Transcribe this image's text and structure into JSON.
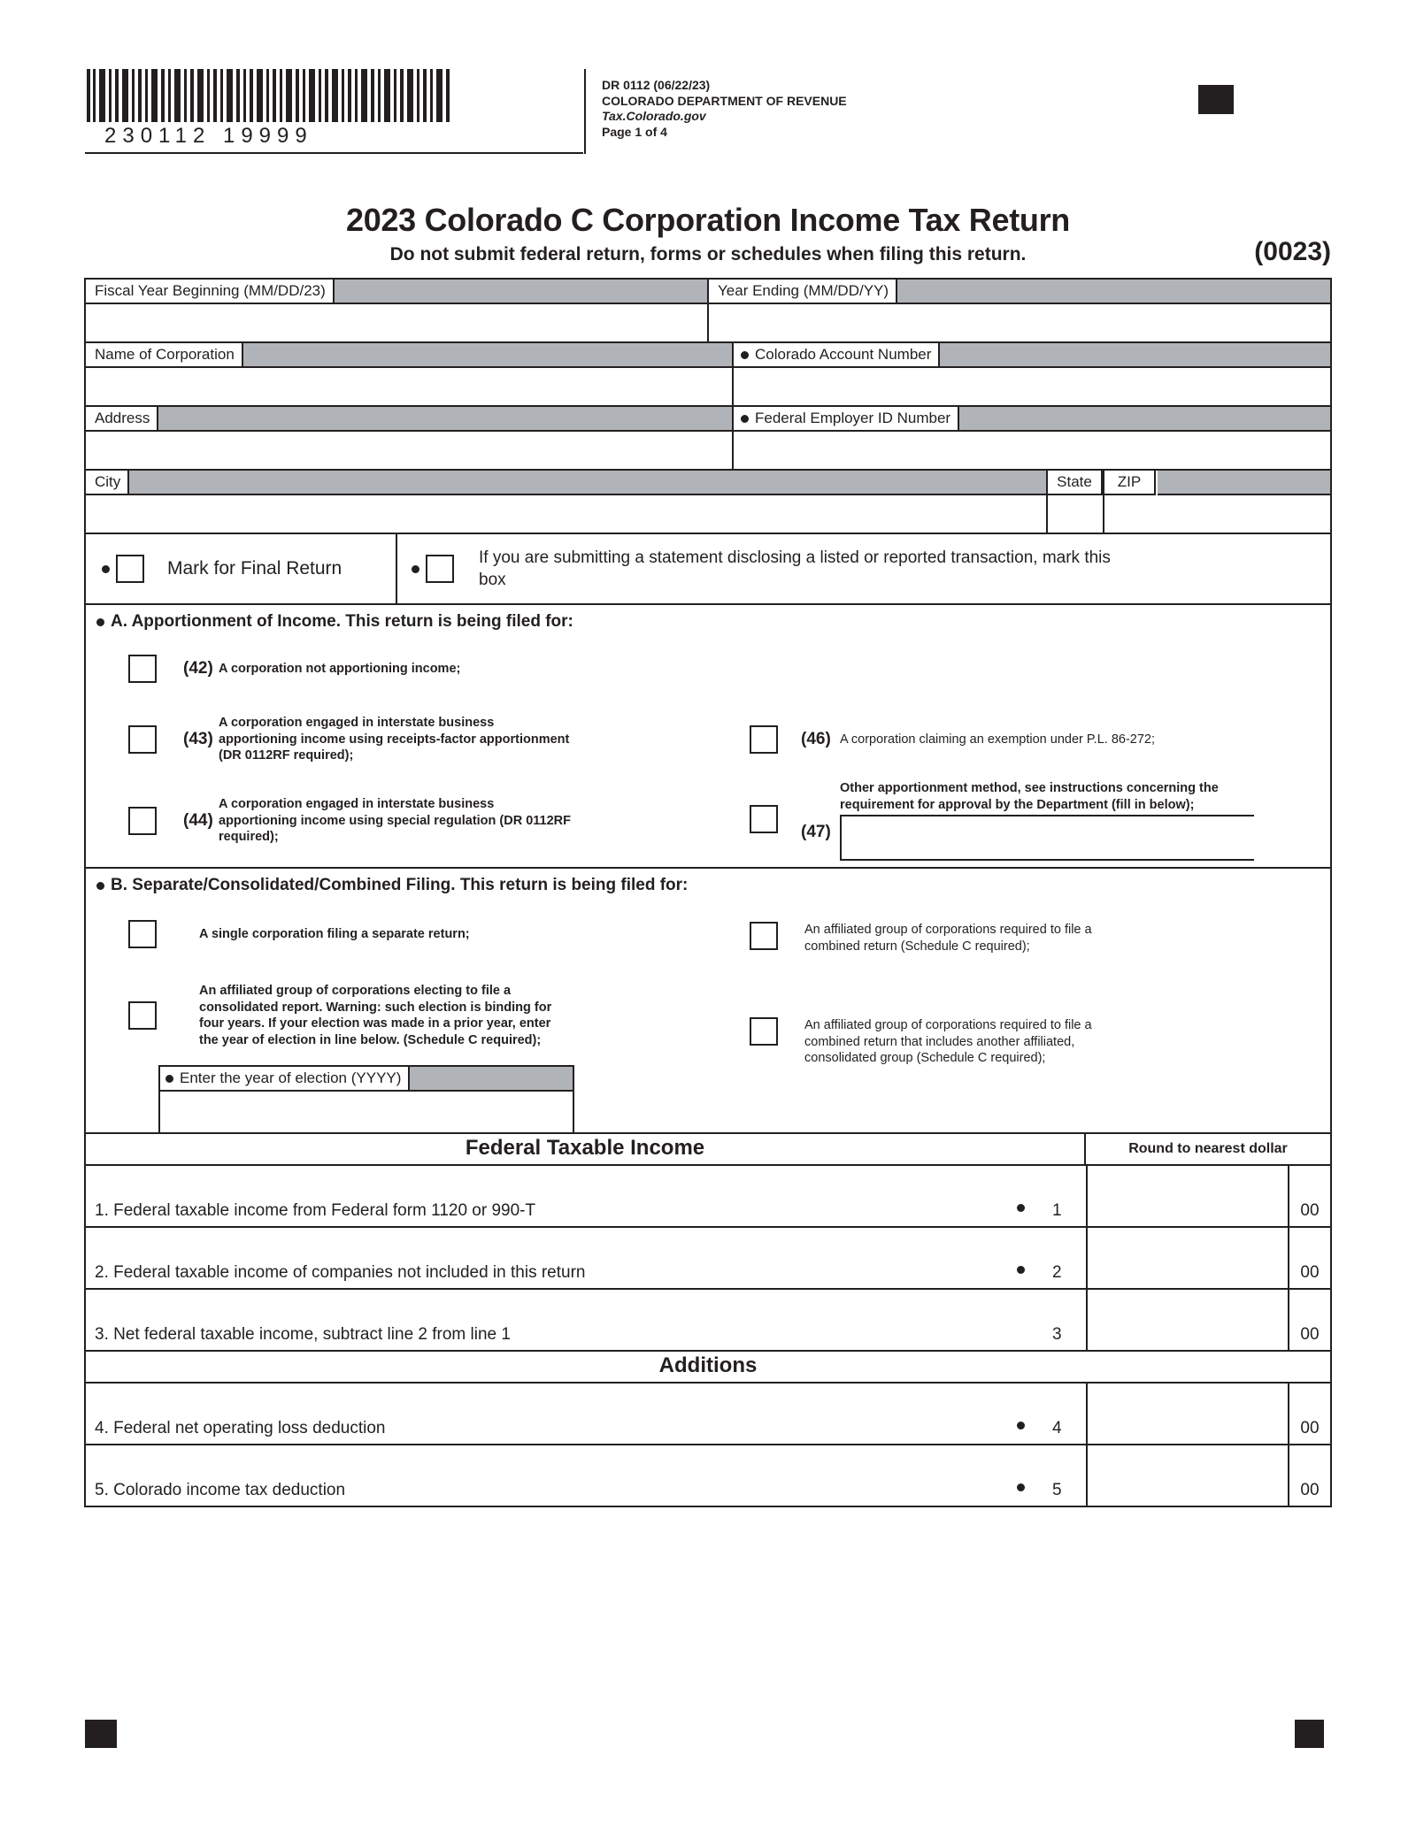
{
  "header": {
    "barcode_number": "230112   19999",
    "form_id": "DR 0112 (06/22/23)",
    "agency": "COLORADO DEPARTMENT OF REVENUE",
    "website": "Tax.Colorado.gov",
    "page": "Page 1 of 4"
  },
  "title": "2023 Colorado C Corporation Income Tax Return",
  "subtitle": "Do not submit federal return, forms or schedules when filing this return.",
  "form_code": "(0023)",
  "fields": {
    "fiscal_year_beginning": "Fiscal Year Beginning (MM/DD/23)",
    "year_ending": "Year Ending (MM/DD/YY)",
    "name_of_corporation": "Name of Corporation",
    "colorado_account_number": "Colorado Account Number",
    "address": "Address",
    "federal_employer_id": "Federal Employer ID Number",
    "city": "City",
    "state": "State",
    "zip": "ZIP",
    "fiscal_year_beginning_value": "",
    "year_ending_value": "",
    "name_of_corporation_value": "",
    "colorado_account_number_value": "",
    "address_value": "",
    "federal_employer_id_value": "",
    "city_value": "",
    "state_value": "",
    "zip_value": ""
  },
  "checkboxes": {
    "final_return": "Mark for Final Return",
    "listed_transaction": "If you are submitting a statement disclosing a listed or reported transaction, mark this box"
  },
  "section_a": {
    "heading": "A. Apportionment of Income. This return is being filed for:",
    "options_left": [
      {
        "num": "(42)",
        "text": "A corporation not apportioning income;"
      },
      {
        "num": "(43)",
        "text": "A corporation engaged in interstate business apportioning income using receipts-factor apportionment (DR 0112RF required);"
      },
      {
        "num": "(44)",
        "text": "A corporation engaged in interstate business apportioning income using special regulation (DR 0112RF required);"
      }
    ],
    "options_right": [
      {
        "num": "(46)",
        "text": "A corporation claiming an exemption under P.L. 86-272;"
      },
      {
        "num": "(47)",
        "text": "Other apportionment method, see instructions concerning the requirement for approval by the Department (fill in below);"
      }
    ],
    "other_method_value": ""
  },
  "section_b": {
    "heading": "B. Separate/Consolidated/Combined Filing. This return is being filed for:",
    "options_left": [
      {
        "text": "A single corporation filing a separate return;"
      },
      {
        "text": "An affiliated group of corporations electing to file a consolidated report. Warning: such election is binding for four years. If your election was made in a prior year, enter the year of election in line below. (Schedule C required);"
      }
    ],
    "options_right": [
      {
        "text": "An affiliated group of corporations required to file a combined return (Schedule C required);"
      },
      {
        "text": "An affiliated group of corporations required to file a combined return that includes another affiliated, consolidated group (Schedule C required);"
      }
    ],
    "year_of_election_label": "Enter the year of election (YYYY)",
    "year_of_election_value": ""
  },
  "bands": {
    "federal_taxable_income": "Federal Taxable Income",
    "round_to_nearest_dollar": "Round to nearest dollar",
    "additions": "Additions"
  },
  "lines": [
    {
      "no": "1",
      "desc": "1. Federal taxable income from Federal form 1120 or 990-T",
      "dot": true,
      "cents": "00",
      "value": ""
    },
    {
      "no": "2",
      "desc": "2. Federal taxable income of companies not included in this return",
      "dot": true,
      "cents": "00",
      "value": ""
    },
    {
      "no": "3",
      "desc": "3. Net federal taxable income, subtract line 2 from line 1",
      "dot": false,
      "cents": "00",
      "value": ""
    },
    {
      "no": "4",
      "desc": "4. Federal net operating loss deduction",
      "dot": true,
      "cents": "00",
      "value": ""
    },
    {
      "no": "5",
      "desc": "5. Colorado income tax deduction",
      "dot": true,
      "cents": "00",
      "value": ""
    }
  ],
  "colors": {
    "ink": "#231f20",
    "shade": "#b0b3b8",
    "paper": "#ffffff"
  }
}
